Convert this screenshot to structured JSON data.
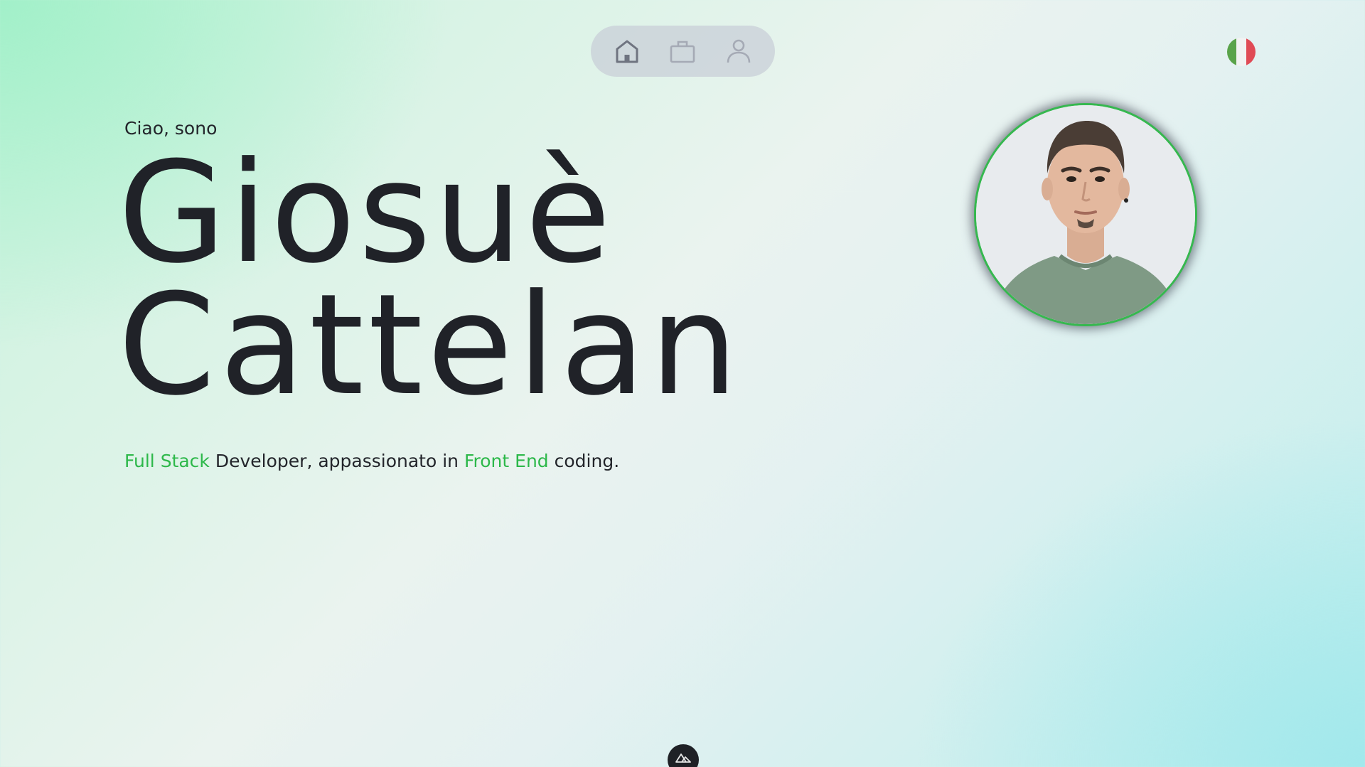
{
  "nav": {
    "items": [
      {
        "name": "home",
        "icon": "home-icon",
        "active": true
      },
      {
        "name": "projects",
        "icon": "briefcase-icon",
        "active": false
      },
      {
        "name": "about",
        "icon": "user-icon",
        "active": false
      }
    ]
  },
  "language": {
    "current": "Italiano",
    "flag_colors": [
      "#5aa34a",
      "#f2f2f2",
      "#e04a55"
    ]
  },
  "hero": {
    "greeting": "Ciao, sono",
    "first_name": "Giosuè",
    "last_name": "Cattelan",
    "tagline": {
      "highlight_1": "Full Stack",
      "text_1": " Developer, appassionato in ",
      "highlight_2": "Front End",
      "text_2": " coding."
    }
  },
  "profile": {
    "avatar_icon": "profile-photo",
    "border_color": "#36b84f"
  },
  "footer": {
    "badge_icon": "nuxt-logo-icon"
  },
  "colors": {
    "accent": "#2db84a",
    "text": "#23252b",
    "nav_bg": "#c8cdd7"
  }
}
